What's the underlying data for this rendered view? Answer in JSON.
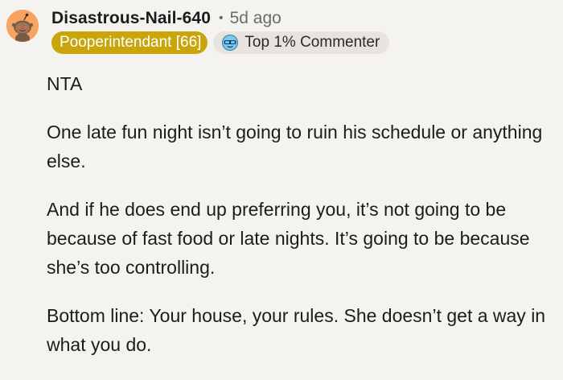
{
  "comment": {
    "avatar_icon": "snoo-avatar-icon",
    "username": "Disastrous-Nail-640",
    "separator": "•",
    "timestamp": "5d ago",
    "flair": {
      "label": "Pooperintendant [66]",
      "color": "#c9a50c"
    },
    "achievement": {
      "icon": "top-commenter-icon",
      "label": "Top 1% Commenter"
    },
    "paragraphs": [
      "NTA",
      "One late fun night isn’t going to ruin his schedule or anything else.",
      "And if he does end up preferring you, it’s not going to be because of fast food or late nights. It’s going to be because she’s too controlling.",
      "Bottom line: Your house, your rules. She doesn’t get a way in what you do."
    ]
  },
  "colors": {
    "background": "#f5f3ef",
    "avatar_bg": "#f7a463",
    "achievement_bg": "#e8e3dc",
    "muted_text": "#6b6b6b"
  }
}
